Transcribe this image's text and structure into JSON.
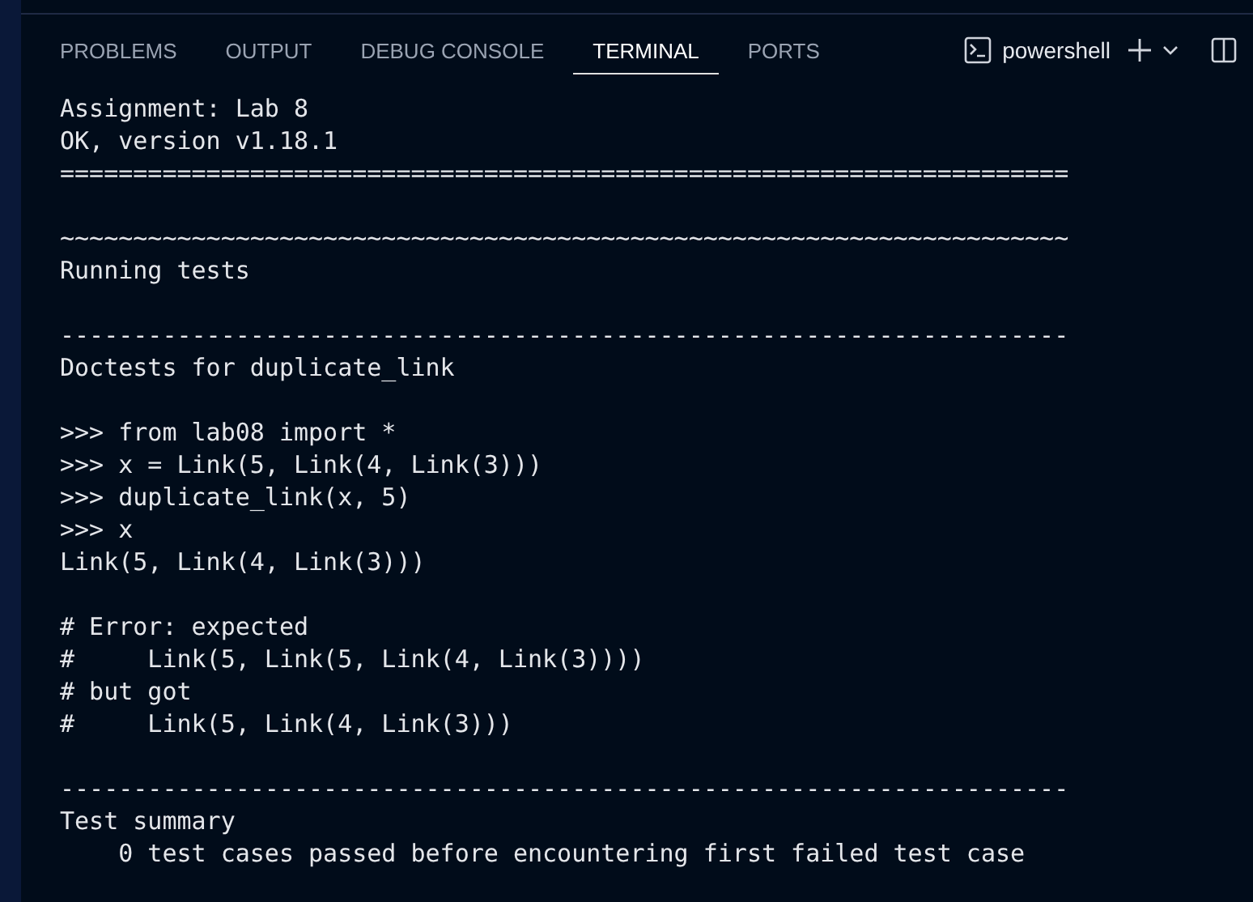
{
  "panel_tabs": [
    {
      "label": "PROBLEMS",
      "selected": false
    },
    {
      "label": "OUTPUT",
      "selected": false
    },
    {
      "label": "DEBUG CONSOLE",
      "selected": false
    },
    {
      "label": "TERMINAL",
      "selected": true
    },
    {
      "label": "PORTS",
      "selected": false
    }
  ],
  "terminal_profile": {
    "label": "powershell"
  },
  "terminal_blocks": [
    {
      "lines": [
        "Assignment: Lab 8",
        "OK, version v1.18.1",
        "====================================================================="
      ]
    },
    {
      "lines": [
        "~~~~~~~~~~~~~~~~~~~~~~~~~~~~~~~~~~~~~~~~~~~~~~~~~~~~~~~~~~~~~~~~~~~~~",
        "Running tests"
      ]
    },
    {
      "lines": [
        "---------------------------------------------------------------------",
        "Doctests for duplicate_link"
      ]
    },
    {
      "lines": [
        ">>> from lab08 import *",
        ">>> x = Link(5, Link(4, Link(3)))",
        ">>> duplicate_link(x, 5)",
        ">>> x",
        "Link(5, Link(4, Link(3)))"
      ]
    },
    {
      "lines": [
        "# Error: expected",
        "#     Link(5, Link(5, Link(4, Link(3))))",
        "# but got",
        "#     Link(5, Link(4, Link(3)))"
      ]
    },
    {
      "lines": [
        "---------------------------------------------------------------------",
        "Test summary",
        "    0 test cases passed before encountering first failed test case"
      ]
    }
  ]
}
